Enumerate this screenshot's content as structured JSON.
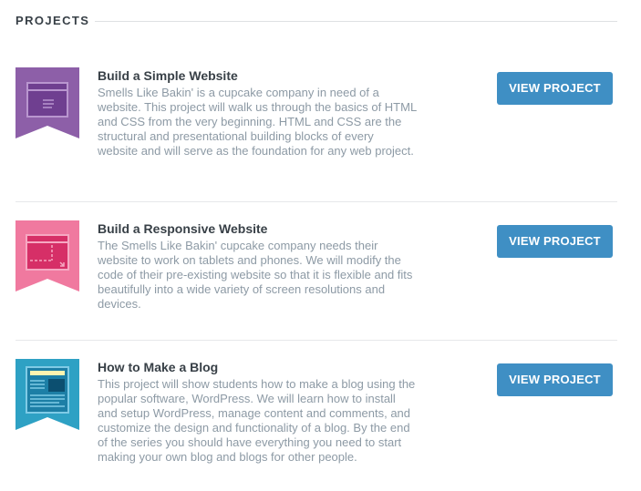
{
  "section": {
    "title": "PROJECTS"
  },
  "projects": [
    {
      "title": "Build a Simple Website",
      "description": "Smells Like Bakin' is a cupcake company in need of a website. This project will walk us through the basics of HTML and CSS from the very beginning. HTML and CSS are the structural and presentational building blocks of every website and will serve as the foundation for any web project.",
      "button_label": "VIEW PROJECT",
      "badge_icon": "simple-website-badge-icon",
      "badge_color": "#8d5fa8"
    },
    {
      "title": "Build a Responsive Website",
      "description": "The Smells Like Bakin' cupcake company needs their website to work on tablets and phones. We will modify the code of their pre-existing website so that it is flexible and fits beautifully into a wide variety of screen resolutions and devices.",
      "button_label": "VIEW PROJECT",
      "badge_icon": "responsive-website-badge-icon",
      "badge_color": "#f0799f"
    },
    {
      "title": "How to Make a Blog",
      "description": "This project will show students how to make a blog using the popular software, WordPress. We will learn how to install and setup WordPress, manage content and comments, and customize the design and functionality of a blog. By the end of the series you should have everything you need to start making your own blog and blogs for other people.",
      "button_label": "VIEW PROJECT",
      "badge_icon": "blog-badge-icon",
      "badge_color": "#2ea1c4"
    }
  ],
  "button_color": "#3f8fc4"
}
